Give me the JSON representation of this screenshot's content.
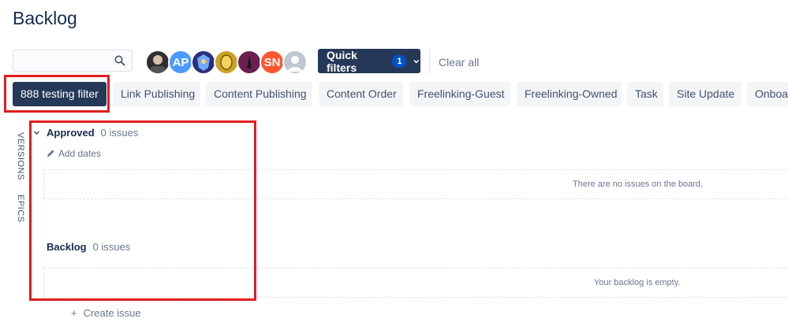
{
  "page": {
    "title": "Backlog"
  },
  "search": {
    "value": "",
    "placeholder": ""
  },
  "avatars": [
    {
      "kind": "photo",
      "bg": "#2f2f2f"
    },
    {
      "initials": "AP",
      "bg": "#4c9aff"
    },
    {
      "kind": "photo",
      "bg": "#2c2f7a"
    },
    {
      "kind": "photo",
      "bg": "#c9a227"
    },
    {
      "kind": "photo",
      "bg": "#6b1f4f"
    },
    {
      "initials": "SN",
      "bg": "#ff5630"
    },
    {
      "kind": "default",
      "bg": "#c1c7d0"
    }
  ],
  "quick_filters": {
    "label": "Quick filters",
    "count": "1"
  },
  "clear_all": "Clear all",
  "filters": [
    "888 testing filter",
    "Link Publishing",
    "Content Publishing",
    "Content Order",
    "Freelinking-Guest",
    "Freelinking-Owned",
    "Task",
    "Site Update",
    "Onboar"
  ],
  "side_tabs": {
    "versions": "VERSIONS",
    "epics": "EPICS"
  },
  "sprints": {
    "approved": {
      "name": "Approved",
      "count": "0 issues",
      "add_dates": "Add dates",
      "empty": "There are no issues on the board."
    },
    "backlog": {
      "name": "Backlog",
      "count": "0 issues",
      "empty": "Your backlog is empty."
    }
  },
  "create_issue": "Create issue",
  "colors": {
    "primary": "#253858",
    "accent": "#0052cc",
    "highlight": "#e01e1e"
  }
}
